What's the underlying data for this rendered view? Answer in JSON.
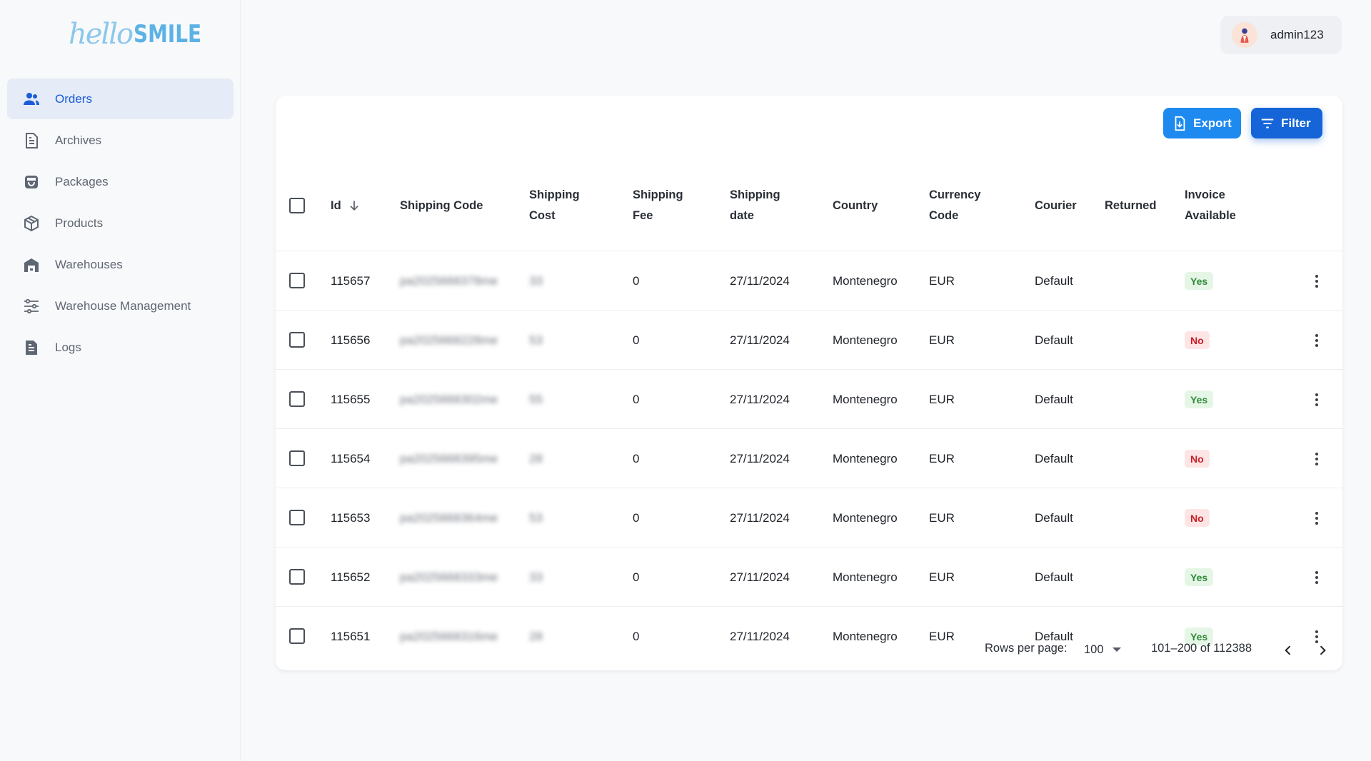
{
  "brand": {
    "script": "hello",
    "bold": "SMILE"
  },
  "user": {
    "name": "admin123"
  },
  "sidebar": {
    "items": [
      {
        "label": "Orders",
        "icon": "users-icon",
        "active": true
      },
      {
        "label": "Archives",
        "icon": "document-icon",
        "active": false
      },
      {
        "label": "Packages",
        "icon": "package-icon",
        "active": false
      },
      {
        "label": "Products",
        "icon": "cube-icon",
        "active": false
      },
      {
        "label": "Warehouses",
        "icon": "warehouse-icon",
        "active": false
      },
      {
        "label": "Warehouse Management",
        "icon": "sliders-icon",
        "active": false
      },
      {
        "label": "Logs",
        "icon": "log-file-icon",
        "active": false
      }
    ]
  },
  "toolbar": {
    "export_label": "Export",
    "filter_label": "Filter"
  },
  "table": {
    "columns": {
      "id": "Id",
      "shipping_code": "Shipping Code",
      "shipping_cost_1": "Shipping",
      "shipping_cost_2": "Cost",
      "shipping_fee_1": "Shipping",
      "shipping_fee_2": "Fee",
      "shipping_date_1": "Shipping",
      "shipping_date_2": "date",
      "country": "Country",
      "currency_1": "Currency",
      "currency_2": "Code",
      "courier": "Courier",
      "returned": "Returned",
      "invoice_1": "Invoice",
      "invoice_2": "Available"
    },
    "sort": {
      "column": "Id",
      "direction": "descending"
    },
    "rows": [
      {
        "id": "115657",
        "shipping_code": "pa2025668378me",
        "shipping_cost": "33",
        "shipping_fee": "0",
        "shipping_date": "27/11/2024",
        "country": "Montenegro",
        "currency": "EUR",
        "courier": "Default",
        "returned": "",
        "invoice": "Yes"
      },
      {
        "id": "115656",
        "shipping_code": "pa2025668228me",
        "shipping_cost": "53",
        "shipping_fee": "0",
        "shipping_date": "27/11/2024",
        "country": "Montenegro",
        "currency": "EUR",
        "courier": "Default",
        "returned": "",
        "invoice": "No"
      },
      {
        "id": "115655",
        "shipping_code": "pa2025668302me",
        "shipping_cost": "55",
        "shipping_fee": "0",
        "shipping_date": "27/11/2024",
        "country": "Montenegro",
        "currency": "EUR",
        "courier": "Default",
        "returned": "",
        "invoice": "Yes"
      },
      {
        "id": "115654",
        "shipping_code": "pa2025668395me",
        "shipping_cost": "28",
        "shipping_fee": "0",
        "shipping_date": "27/11/2024",
        "country": "Montenegro",
        "currency": "EUR",
        "courier": "Default",
        "returned": "",
        "invoice": "No"
      },
      {
        "id": "115653",
        "shipping_code": "pa2025668364me",
        "shipping_cost": "53",
        "shipping_fee": "0",
        "shipping_date": "27/11/2024",
        "country": "Montenegro",
        "currency": "EUR",
        "courier": "Default",
        "returned": "",
        "invoice": "No"
      },
      {
        "id": "115652",
        "shipping_code": "pa2025668333me",
        "shipping_cost": "33",
        "shipping_fee": "0",
        "shipping_date": "27/11/2024",
        "country": "Montenegro",
        "currency": "EUR",
        "courier": "Default",
        "returned": "",
        "invoice": "Yes"
      },
      {
        "id": "115651",
        "shipping_code": "pa2025668316me",
        "shipping_cost": "28",
        "shipping_fee": "0",
        "shipping_date": "27/11/2024",
        "country": "Montenegro",
        "currency": "EUR",
        "courier": "Default",
        "returned": "",
        "invoice": "Yes"
      }
    ]
  },
  "pagination": {
    "rows_per_page_label": "Rows per page:",
    "rows_per_page": "100",
    "range": "101–200 of 112388"
  },
  "colors": {
    "accent": "#1a5bd6",
    "active_nav_bg": "#e5ecf7",
    "export_button": "#1e8af0",
    "filter_button": "#1565d8",
    "yes_badge": "#2f8a37",
    "no_badge": "#c6202a"
  }
}
